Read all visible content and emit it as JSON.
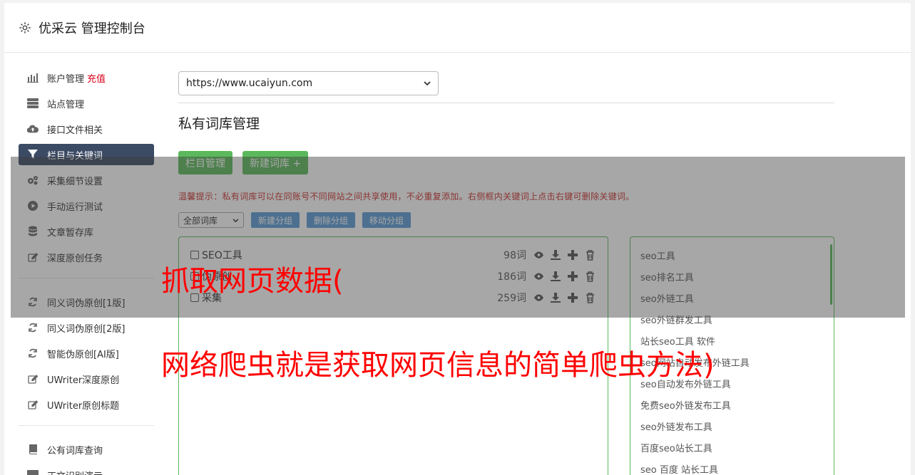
{
  "header": {
    "title": "优采云 管理控制台",
    "icon": "gear-icon"
  },
  "sidebar": {
    "recharge_label": "充值",
    "items": [
      {
        "label": "账户管理",
        "icon": "bar-chart-icon"
      },
      {
        "label": "站点管理",
        "icon": "server-icon"
      },
      {
        "label": "接口文件相关",
        "icon": "cloud-upload-icon"
      },
      {
        "label": "栏目与关键词",
        "icon": "filter-icon",
        "active": true
      },
      {
        "label": "采集细节设置",
        "icon": "cogs-icon"
      },
      {
        "label": "手动运行测试",
        "icon": "play-circle-icon"
      },
      {
        "label": "文章暂存库",
        "icon": "database-icon"
      },
      {
        "label": "深度原创任务",
        "icon": "edit-icon"
      },
      {
        "label": "同义词伪原创[1版]",
        "icon": "refresh-icon"
      },
      {
        "label": "同义词伪原创[2版]",
        "icon": "refresh-icon"
      },
      {
        "label": "智能伪原创[AI版]",
        "icon": "refresh-icon"
      },
      {
        "label": "UWriter深度原创",
        "icon": "edit-icon"
      },
      {
        "label": "UWriter原创标题",
        "icon": "edit-icon"
      },
      {
        "label": "公有词库查询",
        "icon": "book-icon"
      },
      {
        "label": "正文识别演示",
        "icon": "monitor-icon"
      }
    ]
  },
  "main": {
    "site_select_value": "https://www.ucaiyun.com",
    "page_title": "私有词库管理",
    "btn_column": "栏目管理",
    "btn_new_lib": "新建词库 +",
    "tip": "温馨提示：私有词库可以在同账号不同网站之间共享使用，不必重复添加。右侧框内关键词上点击右键可删除关键词。",
    "group_select_value": "全部词库",
    "btn_new_group": "新建分组",
    "btn_delete_group": "删除分组",
    "btn_move_group": "移动分组",
    "libraries": [
      {
        "name": "SEO工具",
        "count": "98词"
      },
      {
        "name": "伪原创",
        "count": "186词"
      },
      {
        "name": "采集",
        "count": "259词"
      }
    ],
    "keywords": [
      "seo工具",
      "seo排名工具",
      "seo外链工具",
      "seo外链群发工具",
      "站长seo工具 软件",
      "seo网站自动发布外链工具",
      "seo自动发布外链工具",
      "免费seo外链发布工具",
      "seo外链发布工具",
      "百度seo站长工具",
      "seo 百度 站长工具"
    ]
  },
  "overlay": {
    "line1": "抓取网页数据(",
    "line2": "网络爬虫就是获取网页信息的简单爬虫方法)"
  }
}
